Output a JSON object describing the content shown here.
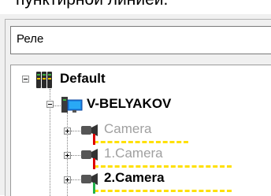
{
  "caption": "пунктирной линией.",
  "search": {
    "value": "Реле"
  },
  "tree": {
    "root": {
      "label": "Default"
    },
    "server": {
      "label": "V-BELYAKOV"
    },
    "cameras": [
      {
        "label": "Camera",
        "state": "disabled"
      },
      {
        "label": "1.Camera",
        "state": "disabled"
      },
      {
        "label": "2.Camera",
        "state": "enabled"
      }
    ]
  },
  "colors": {
    "dashed_link": "#ffe000",
    "disabled_text": "#a0a0a0"
  }
}
